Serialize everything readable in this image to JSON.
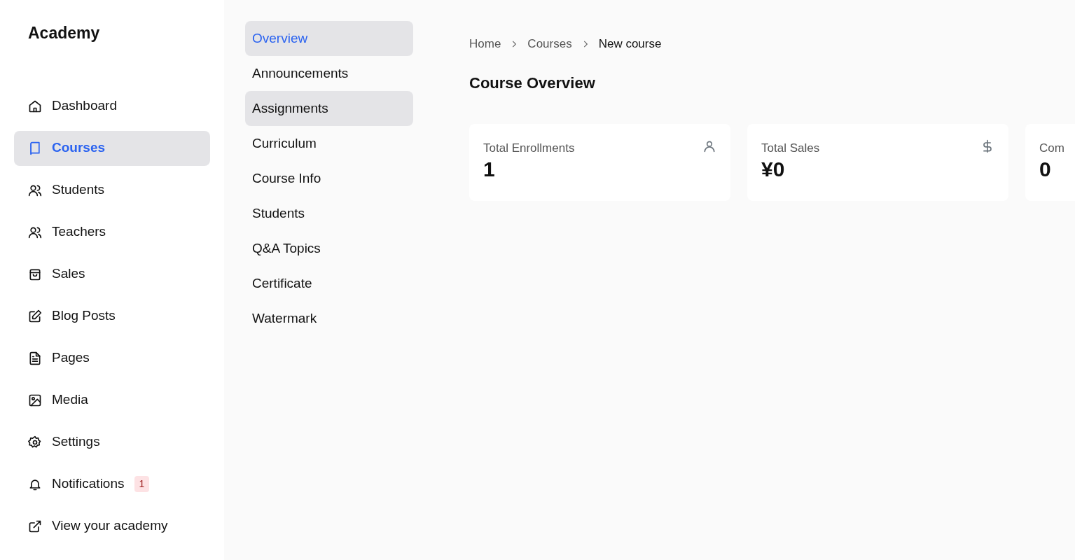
{
  "sidebar": {
    "brand": "Academy",
    "items": [
      {
        "label": "Dashboard",
        "selected": false
      },
      {
        "label": "Courses",
        "selected": true
      },
      {
        "label": "Students",
        "selected": false
      },
      {
        "label": "Teachers",
        "selected": false
      },
      {
        "label": "Sales",
        "selected": false
      },
      {
        "label": "Blog Posts",
        "selected": false
      },
      {
        "label": "Pages",
        "selected": false
      },
      {
        "label": "Media",
        "selected": false
      },
      {
        "label": "Settings",
        "selected": false
      },
      {
        "label": "Notifications",
        "selected": false,
        "badge": "1"
      },
      {
        "label": "View your academy",
        "selected": false
      }
    ]
  },
  "course_nav": {
    "items": [
      {
        "label": "Overview",
        "selected": true,
        "highlighted": false
      },
      {
        "label": "Announcements",
        "selected": false,
        "highlighted": false
      },
      {
        "label": "Assignments",
        "selected": false,
        "highlighted": true
      },
      {
        "label": "Curriculum",
        "selected": false,
        "highlighted": false
      },
      {
        "label": "Course Info",
        "selected": false,
        "highlighted": false
      },
      {
        "label": "Students",
        "selected": false,
        "highlighted": false
      },
      {
        "label": "Q&A Topics",
        "selected": false,
        "highlighted": false
      },
      {
        "label": "Certificate",
        "selected": false,
        "highlighted": false
      },
      {
        "label": "Watermark",
        "selected": false,
        "highlighted": false
      }
    ]
  },
  "breadcrumb": [
    "Home",
    "Courses",
    "New course"
  ],
  "title": "Course Overview",
  "stats": [
    {
      "label": "Total Enrollments",
      "value": "1"
    },
    {
      "label": "Total Sales",
      "value": "¥0"
    },
    {
      "label": "Com",
      "value": "0"
    }
  ]
}
